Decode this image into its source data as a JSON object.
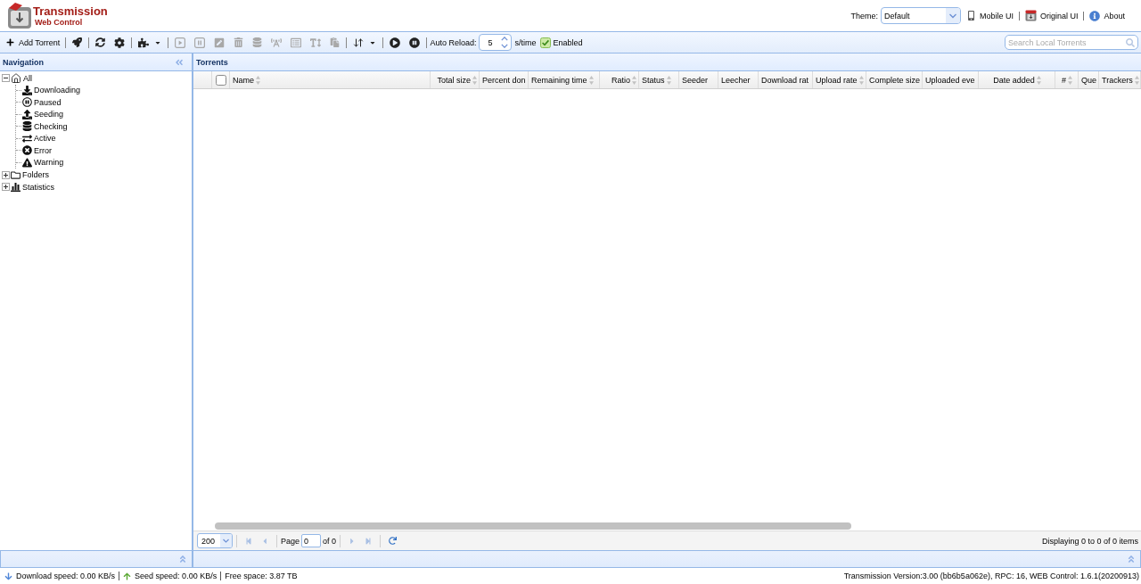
{
  "header": {
    "title": "Transmission",
    "subtitle": "Web Control",
    "theme": {
      "label": "Theme:",
      "value": "Default"
    },
    "links": [
      {
        "label": "Mobile UI"
      },
      {
        "label": "Original UI"
      },
      {
        "label": "About"
      }
    ]
  },
  "toolbar": {
    "groups": [
      [
        {
          "kind": "button",
          "label": "Add Torrent",
          "disabled": false
        }
      ],
      [
        {
          "kind": "icon",
          "disabled": false
        }
      ],
      [
        {
          "kind": "icon",
          "disabled": false
        },
        {
          "kind": "icon",
          "disabled": false
        }
      ],
      [
        {
          "kind": "dropdown",
          "disabled": false
        }
      ],
      [
        {
          "kind": "icon",
          "disabled": true
        },
        {
          "kind": "icon",
          "disabled": true
        },
        {
          "kind": "icon",
          "disabled": true
        },
        {
          "kind": "icon",
          "disabled": true
        },
        {
          "kind": "icon",
          "disabled": true
        },
        {
          "kind": "icon",
          "disabled": true
        },
        {
          "kind": "icon",
          "disabled": true
        },
        {
          "kind": "icon",
          "disabled": true
        },
        {
          "kind": "icon",
          "disabled": true
        }
      ],
      [
        {
          "kind": "dropdown",
          "disabled": false
        }
      ],
      [
        {
          "kind": "icon",
          "disabled": false
        },
        {
          "kind": "icon",
          "disabled": false
        }
      ]
    ],
    "auto_reload": {
      "label": "Auto Reload:",
      "value": "5",
      "unit": "s/time",
      "enabled_label": "Enabled",
      "enabled": true
    },
    "search": {
      "placeholder": "Search Local Torrents"
    }
  },
  "navigation": {
    "title": "Navigation",
    "tree": [
      {
        "label": "All",
        "expanded": true,
        "selected": false,
        "children": [
          {
            "label": "Downloading",
            "selected": false
          },
          {
            "label": "Paused",
            "selected": false
          },
          {
            "label": "Seeding",
            "selected": false
          },
          {
            "label": "Checking",
            "selected": false
          },
          {
            "label": "Active",
            "selected": false
          },
          {
            "label": "Error",
            "selected": false
          },
          {
            "label": "Warning",
            "selected": false
          }
        ]
      },
      {
        "label": "Folders",
        "expanded": false,
        "selected": false
      },
      {
        "label": "Statistics",
        "expanded": false,
        "selected": false
      }
    ]
  },
  "torrents": {
    "title": "Torrents",
    "select_all": {
      "checked": false
    },
    "columns": [
      {
        "label": "Name",
        "sort_icon": true
      },
      {
        "label": "Total size",
        "sort_icon": true
      },
      {
        "label": "Percent don"
      },
      {
        "label": "Remaining time",
        "sort_icon": true
      },
      {
        "label": "Ratio",
        "sort_icon": true
      },
      {
        "label": "Status",
        "sort_icon": true
      },
      {
        "label": "Seeder"
      },
      {
        "label": "Leecher"
      },
      {
        "label": "Download rat"
      },
      {
        "label": "Upload rate",
        "sort_icon": true
      },
      {
        "label": "Complete size"
      },
      {
        "label": "Uploaded eve"
      },
      {
        "label": "Date added",
        "sort_icon": true
      },
      {
        "label": "#",
        "sort_icon": true
      },
      {
        "label": "Que"
      },
      {
        "label": "Trackers",
        "sort_icon": true
      }
    ],
    "pager": {
      "page_size": "200",
      "back_buttons": [
        {
          "disabled": true
        },
        {
          "disabled": true
        }
      ],
      "page_label": "Page",
      "page": "0",
      "page_total": "of 0",
      "forward_buttons": [
        {
          "disabled": true
        },
        {
          "disabled": true
        }
      ],
      "summary": "Displaying 0 to 0 of 0 items"
    }
  },
  "status_bar": {
    "download_speed": "Download speed: 0.00 KB/s",
    "seed_speed": "Seed speed: 0.00 KB/s",
    "free_space": "Free space: 3.87 TB",
    "version": "Transmission Version:3.00 (bb6b5a062e), RPC: 16, WEB Control: 1.6.1(20200913)"
  }
}
